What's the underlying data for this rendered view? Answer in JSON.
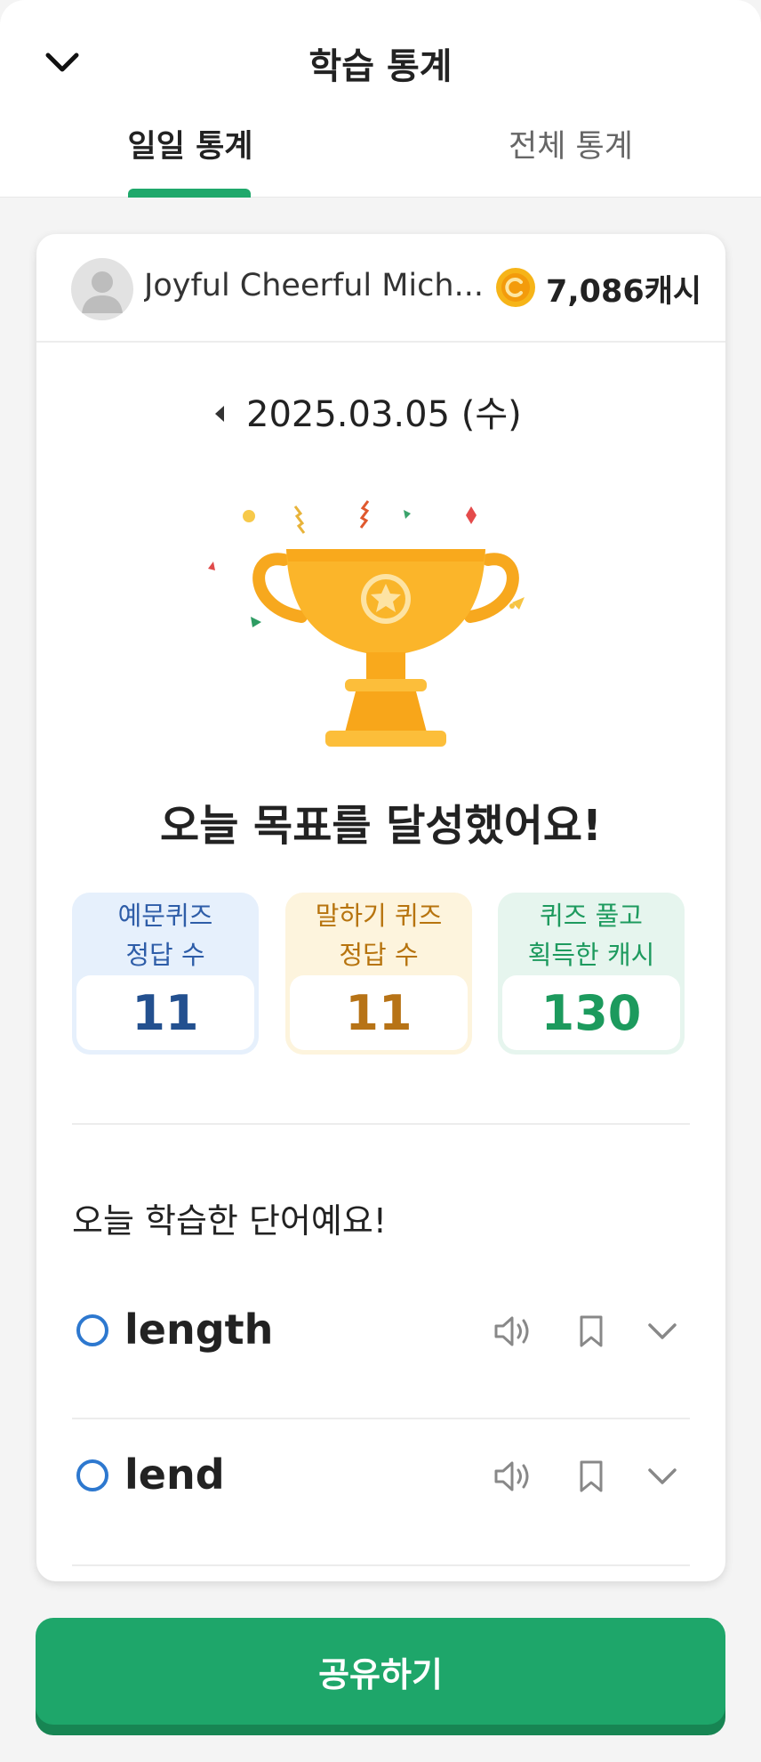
{
  "header": {
    "title": "학습 통계",
    "tabs": [
      {
        "label": "일일 통계",
        "active": true
      },
      {
        "label": "전체 통계",
        "active": false
      }
    ]
  },
  "profile": {
    "name": "Joyful Cheerful Mich...",
    "cash": "7,086캐시"
  },
  "date": "2025.03.05 (수)",
  "goal_message": "오늘 목표를 달성했어요!",
  "stats": [
    {
      "label_line1": "예문퀴즈",
      "label_line2": "정답 수",
      "value": "11"
    },
    {
      "label_line1": "말하기 퀴즈",
      "label_line2": "정답 수",
      "value": "11"
    },
    {
      "label_line1": "퀴즈 풀고",
      "label_line2": "획득한 캐시",
      "value": "130"
    }
  ],
  "learned": {
    "title": "오늘 학습한 단어예요!",
    "words": [
      {
        "word": "length"
      },
      {
        "word": "lend"
      }
    ]
  },
  "share_label": "공유하기",
  "colors": {
    "accent": "#1fa86b",
    "stat_blue": "#23508f",
    "stat_orange": "#b77316",
    "stat_green": "#1c9a5d",
    "word_circle": "#2d78cf"
  },
  "icons": [
    "chevron-down-icon",
    "coin-icon",
    "caret-left-icon",
    "trophy-icon",
    "speaker-icon",
    "bookmark-icon"
  ]
}
